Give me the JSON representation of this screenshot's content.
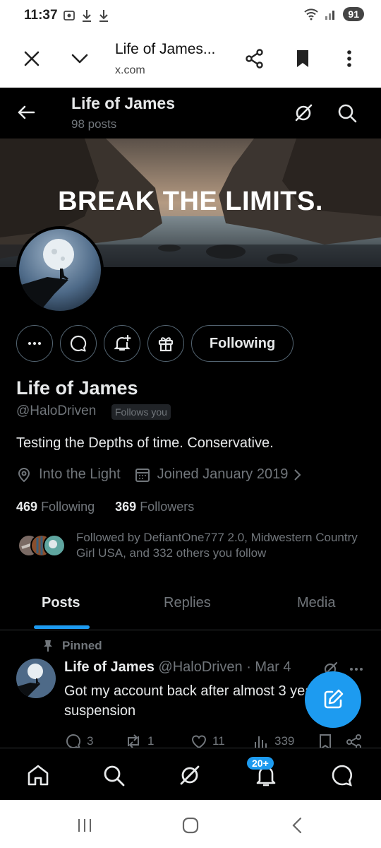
{
  "status_bar": {
    "time": "11:37",
    "battery": "91"
  },
  "browser": {
    "title": "Life of James...",
    "url": "x.com"
  },
  "header": {
    "name": "Life of James",
    "posts_count": "98 posts"
  },
  "banner": {
    "text": "BREAK THE LIMITS."
  },
  "profile": {
    "name": "Life of James",
    "handle": "@HaloDriven",
    "follows_you": "Follows you",
    "bio": "Testing the Depths of time. Conservative.",
    "location": "Into the Light",
    "joined": "Joined January 2019",
    "following_count": "469",
    "following_label": "Following",
    "followers_count": "369",
    "followers_label": "Followers",
    "followed_by": "Followed by DefiantOne777 2.0, Midwestern Country Girl USA, and 332 others you follow",
    "follow_button": "Following"
  },
  "tabs": [
    {
      "label": "Posts",
      "active": true
    },
    {
      "label": "Replies",
      "active": false
    },
    {
      "label": "Media",
      "active": false
    }
  ],
  "post": {
    "pinned_label": "Pinned",
    "author": "Life of James",
    "handle": "@HaloDriven",
    "date": "· Mar 4",
    "text": "Got my account back after almost 3 years of suspension",
    "replies": "3",
    "reposts": "1",
    "likes": "11",
    "views": "339"
  },
  "bottom_nav": {
    "notifications_badge": "20+"
  },
  "colors": {
    "accent": "#1d9bf0",
    "background": "#000000",
    "secondary_text": "#71767b"
  }
}
